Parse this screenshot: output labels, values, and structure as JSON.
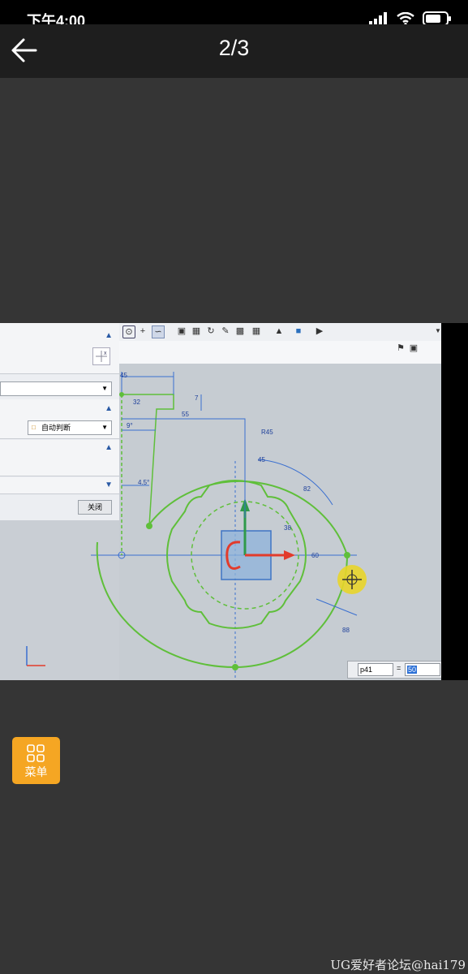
{
  "status_bar": {
    "time": "下午4:00"
  },
  "nav": {
    "pager": "2/3"
  },
  "screenshot": {
    "dialog": {
      "auto_infer_label": "自动判断",
      "close_label": "关闭"
    },
    "dims": {
      "d45": "45",
      "d32": "32",
      "d7": "7",
      "d55": "55",
      "d9": "9°",
      "d45b": "4.5°",
      "dr45": "R45",
      "d45c": "45",
      "d82": "82",
      "d38": "38",
      "d88": "88",
      "d60": "60"
    },
    "input": {
      "name": "p41",
      "equals": "=",
      "value": "50"
    }
  },
  "menu": {
    "label": "菜单"
  },
  "watermark": "UG爱好者论坛@hai179"
}
